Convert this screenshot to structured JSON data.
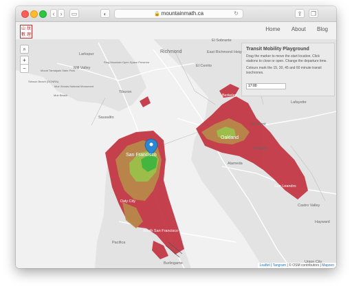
{
  "browser": {
    "url": "mountainmath.ca",
    "back_icon": "chevron-left-icon",
    "forward_icon": "chevron-right-icon"
  },
  "site": {
    "logo_text": "山 紋 數 理",
    "nav": [
      "Home",
      "About",
      "Blog"
    ]
  },
  "map_controls": {
    "search_icon": "search-icon",
    "zoom_in": "+",
    "zoom_out": "−"
  },
  "panel": {
    "title": "Transit Mobility Playground",
    "instructions": "Drag the marker to move the start location. Click stations to close or open. Change the departure time.",
    "legend_text": "Colours mark the 15, 30, 45 and 60 minute transit isochrones.",
    "departure_time": "17:00"
  },
  "map_labels": {
    "richmond": "Richmond",
    "el_sobrante": "El Sobrante",
    "el_cerrito": "El Cerrito",
    "east_richmond": "East Richmond Heights",
    "larkspur": "Larkspur",
    "mill_valley": "Mill Valley",
    "tiburon": "Tiburon",
    "sausalito": "Sausalito",
    "berkeley": "Berkeley",
    "oakland": "Oakland",
    "piedmont": "Piedmont",
    "alameda": "Alameda",
    "san_francisco": "San Francisco",
    "san_leandro": "San Leandro",
    "castro_valley": "Castro Valley",
    "hayward": "Hayward",
    "daly_city": "Daly City",
    "south_sf": "South San Francisco",
    "pacifica": "Pacifica",
    "burlingame": "Burlingame",
    "union_city": "Union City",
    "lafayette": "Lafayette",
    "mt_tamalpais": "Mount Tamalpais State Park",
    "muir_woods": "Muir Woods National Monument",
    "muir_beach": "Muir Beach",
    "stinson": "Stinson Beach (GGNRA)",
    "ring_mountain": "Ring Mountain Open Space Preserve",
    "fruitvale": "Fruitvale"
  },
  "isochrone_colors": {
    "min15": "#3fb53f",
    "min30": "#9ac04a",
    "min45": "#b8884a",
    "min60": "#c23340"
  },
  "marker_color": "#2b87d1",
  "attribution": {
    "leaflet": "Leaflet",
    "tangram": "Tangram",
    "osm": "© OSM contributors",
    "mapzen": "Mapzen"
  }
}
